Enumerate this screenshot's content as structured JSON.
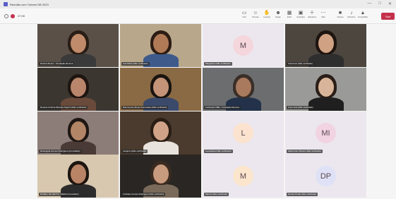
{
  "window": {
    "title": "Reunião com Tutores DB 2023",
    "controls": [
      "—",
      "□",
      "✕"
    ]
  },
  "toolbar": {
    "timer": "47:08",
    "tools": [
      {
        "icon": "chat-icon",
        "label": "Chat"
      },
      {
        "icon": "people-icon",
        "label": "Pessoas"
      },
      {
        "icon": "raise-hand-icon",
        "label": "Levantar"
      },
      {
        "icon": "react-icon",
        "label": "Reagir"
      },
      {
        "icon": "view-icon",
        "label": "Exibir"
      },
      {
        "icon": "rooms-icon",
        "label": "Anotações"
      },
      {
        "icon": "apps-icon",
        "label": "Aplicativos"
      },
      {
        "icon": "more-icon",
        "label": "Mais"
      },
      {
        "icon": "camera-icon",
        "label": "Câmera"
      },
      {
        "icon": "mic-icon",
        "label": "Microfone"
      },
      {
        "icon": "share-icon",
        "label": "Compartilhar"
      }
    ],
    "leave_label": "Sair"
  },
  "participants": [
    {
      "name": "Debora Moura - Fundação Renova",
      "type": "video"
    },
    {
      "name": "Ana Maria (Não verificado)",
      "type": "video"
    },
    {
      "name": "Margarete (Não verificado)",
      "type": "avatar",
      "initials": "M",
      "color": "#f4d6dc"
    },
    {
      "name": "Francisca (Não verificado)",
      "type": "video"
    },
    {
      "name": "Rosana Cristina Miranda Negrini (Não verificado)",
      "type": "video"
    },
    {
      "name": "Rita Gomes Moura Fernandes (Não verificado)",
      "type": "video"
    },
    {
      "name": "Instituição DBE - Fundação Renova",
      "type": "video"
    },
    {
      "name": "Ana Lúcia (Não verificado)",
      "type": "video"
    },
    {
      "name": "Rosangela Gomes Rodrigues (Convidado)",
      "type": "video"
    },
    {
      "name": "Joaquim (Não verificado)",
      "type": "video"
    },
    {
      "name": "Leopoldina (Não verificado)",
      "type": "avatar",
      "initials": "L",
      "color": "#fbe3cf"
    },
    {
      "name": "Maria Inês Oliveira (Não verificado)",
      "type": "avatar",
      "initials": "MI",
      "color": "#f1d3e1"
    },
    {
      "name": "ROSELI DE NETTO VIEIRA (Convidado)",
      "type": "video"
    },
    {
      "name": "Cristiane Fontes Rodrigues (Não verificado)",
      "type": "video"
    },
    {
      "name": "Marina (Não verificado)",
      "type": "avatar",
      "initials": "M",
      "color": "#fbe5cc"
    },
    {
      "name": "Denise Prado (Não verificado)",
      "type": "avatar",
      "initials": "DP",
      "color": "#dfe1f7"
    }
  ]
}
